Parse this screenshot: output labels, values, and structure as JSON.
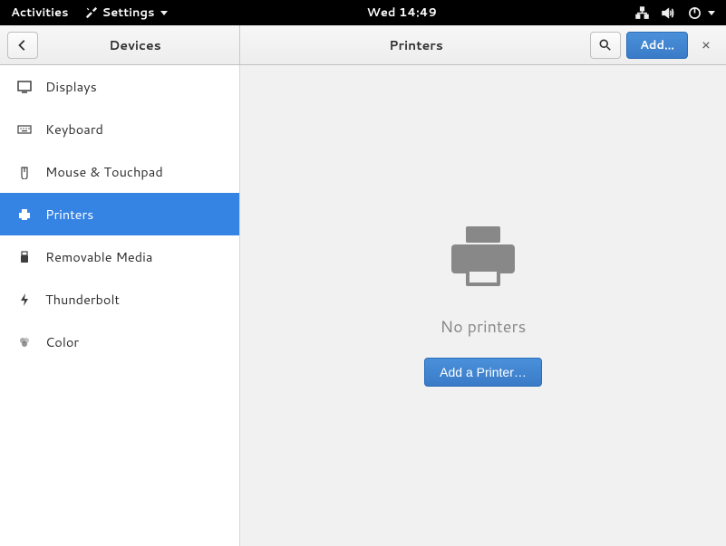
{
  "topbar": {
    "activities": "Activities",
    "settings": "Settings",
    "clock": "Wed 14:49"
  },
  "header": {
    "left_title": "Devices",
    "right_title": "Printers",
    "add_button": "Add…"
  },
  "sidebar": {
    "items": [
      {
        "label": "Displays"
      },
      {
        "label": "Keyboard"
      },
      {
        "label": "Mouse & Touchpad"
      },
      {
        "label": "Printers"
      },
      {
        "label": "Removable Media"
      },
      {
        "label": "Thunderbolt"
      },
      {
        "label": "Color"
      }
    ]
  },
  "main": {
    "empty_text": "No printers",
    "add_printer": "Add a Printer…"
  }
}
